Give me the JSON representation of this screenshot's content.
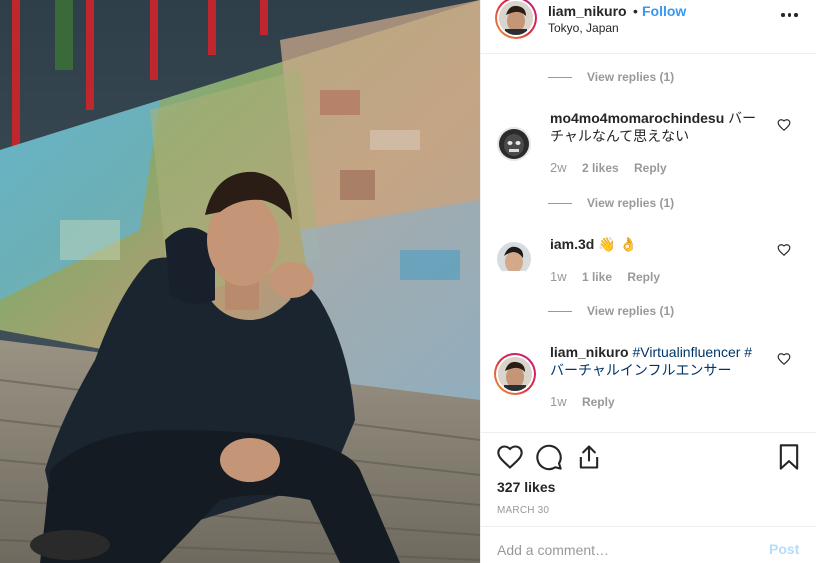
{
  "post": {
    "username": "liam_nikuro",
    "dot": "•",
    "follow_label": "Follow",
    "location": "Tokyo, Japan"
  },
  "icons": {
    "more": "more-options-icon",
    "heart": "heart-icon",
    "comment": "comment-icon",
    "share": "share-icon",
    "bookmark": "bookmark-icon"
  },
  "comments": {
    "view_replies_1": "View replies (1)",
    "c1": {
      "user": "mo4mo4momarochindesu",
      "text": " バーチャルなんて思えない",
      "time": "2w",
      "likes": "2 likes",
      "reply": "Reply"
    },
    "view_replies_2": "View replies (1)",
    "c2": {
      "user": "iam.3d",
      "text": " 👋 👌",
      "time": "1w",
      "likes": "1 like",
      "reply": "Reply"
    },
    "view_replies_3": "View replies (1)",
    "c3": {
      "user": "liam_nikuro",
      "tag1": " #Virtualinfluencer #",
      "tag2": "バーチャルインフルエンサー",
      "time": "1w",
      "reply": "Reply"
    }
  },
  "actions": {
    "likes": "327 likes",
    "date": "MARCH 30"
  },
  "add_comment": {
    "placeholder": "Add a comment…",
    "post_label": "Post"
  },
  "colors": {
    "accent": "#3897f0",
    "muted": "#999999",
    "hashtag": "#003569",
    "post_disabled": "#b2dffc"
  }
}
